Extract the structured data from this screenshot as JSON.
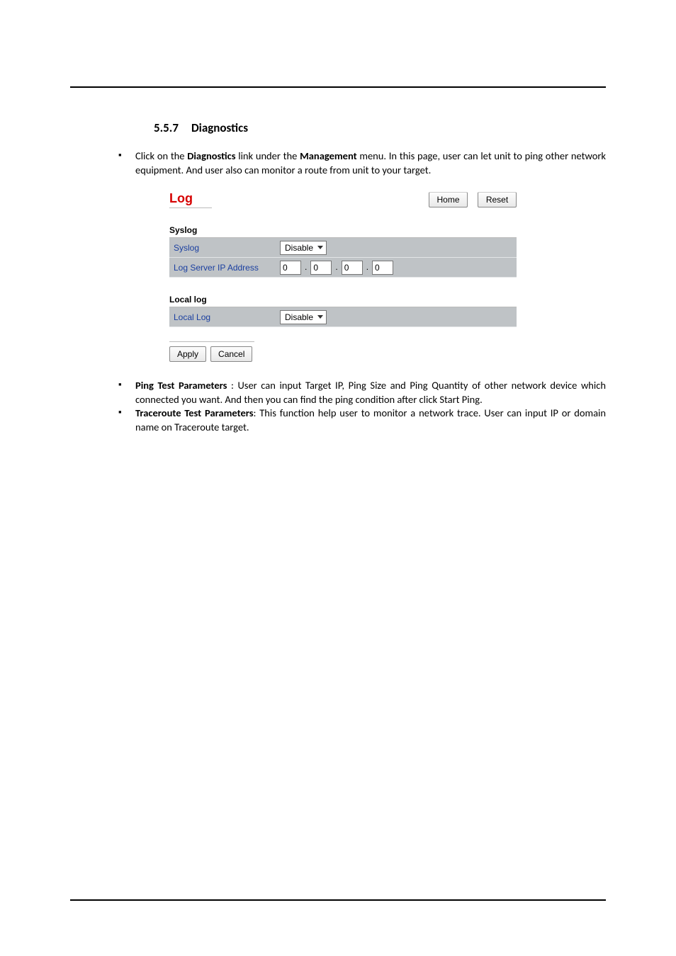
{
  "heading": {
    "number": "5.5.7",
    "title": "Diagnostics"
  },
  "intro": {
    "pre": "Click on the ",
    "bold1": "Diagnostics",
    "mid": " link under the ",
    "bold2": "Management",
    "post": " menu. In this page, user can let unit to ping other network equipment. And user also can monitor a route from unit to your target."
  },
  "panel": {
    "title": "Log",
    "home": "Home",
    "reset": "Reset",
    "syslog_section": "Syslog",
    "syslog_label": "Syslog",
    "syslog_value": "Disable",
    "ip_label": "Log Server IP Address",
    "ip": {
      "a": "0",
      "b": "0",
      "c": "0",
      "d": "0"
    },
    "locallog_section": "Local log",
    "locallog_label": "Local Log",
    "locallog_value": "Disable",
    "apply": "Apply",
    "cancel": "Cancel"
  },
  "bullets": {
    "ping": {
      "bold": "Ping Test Parameters",
      "rest": " : User can input Target IP, Ping Size and Ping Quantity of other network device which connected you want. And then you can find the ping condition after click Start Ping."
    },
    "trace": {
      "bold": "Traceroute Test Parameters",
      "rest": ": This function help user to monitor a network trace. User can input IP or domain name on Traceroute target."
    }
  }
}
